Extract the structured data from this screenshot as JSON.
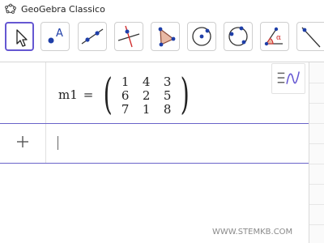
{
  "window": {
    "title": "GeoGebra Classico"
  },
  "toolbar": {
    "tools": [
      {
        "icon": "move-arrow-icon",
        "selected": true
      },
      {
        "icon": "point-icon",
        "label": "A"
      },
      {
        "icon": "line-icon"
      },
      {
        "icon": "perpendicular-line-icon"
      },
      {
        "icon": "polygon-icon"
      },
      {
        "icon": "circle-center-point-icon"
      },
      {
        "icon": "circle-three-points-icon"
      },
      {
        "icon": "angle-icon",
        "label": "α"
      },
      {
        "icon": "reflect-about-line-icon"
      }
    ]
  },
  "algebra": {
    "rows": [
      {
        "name": "m1",
        "equals": "=",
        "matrix": [
          [
            "1",
            "4",
            "3"
          ],
          [
            "6",
            "2",
            "5"
          ],
          [
            "7",
            "1",
            "8"
          ]
        ]
      }
    ],
    "input": {
      "placeholder": ""
    }
  },
  "colors": {
    "accent": "#6557d2",
    "row_divider": "#6a63c9"
  },
  "watermark": "WWW.STEMKB.COM"
}
